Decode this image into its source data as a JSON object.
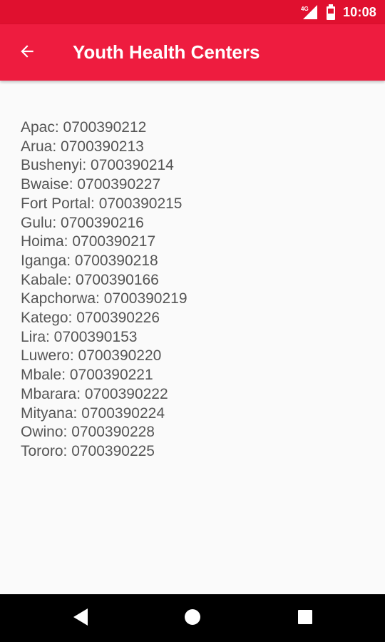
{
  "status_bar": {
    "network_label": "4G",
    "time": "10:08",
    "icons": [
      "signal-icon",
      "battery-icon"
    ]
  },
  "app_bar": {
    "title": "Youth Health Centers",
    "back_icon": "arrow-back-icon",
    "color": "#ee1c3f"
  },
  "centers": [
    "Apac: 0700390212",
    "Arua: 0700390213",
    "Bushenyi: 0700390214",
    "Bwaise: 0700390227",
    "Fort Portal: 0700390215",
    "Gulu: 0700390216",
    "Hoima: 0700390217",
    "Iganga: 0700390218",
    "Kabale: 0700390166",
    "Kapchorwa: 0700390219",
    "Katego: 0700390226",
    "Lira: 0700390153",
    "Luwero: 0700390220",
    "Mbale: 0700390221",
    "Mbarara: 0700390222",
    "Mityana: 0700390224",
    "Owino: 0700390228",
    "Tororo: 0700390225"
  ],
  "nav_bar": {
    "buttons": [
      "back-triangle-icon",
      "home-circle-icon",
      "recents-square-icon"
    ]
  }
}
